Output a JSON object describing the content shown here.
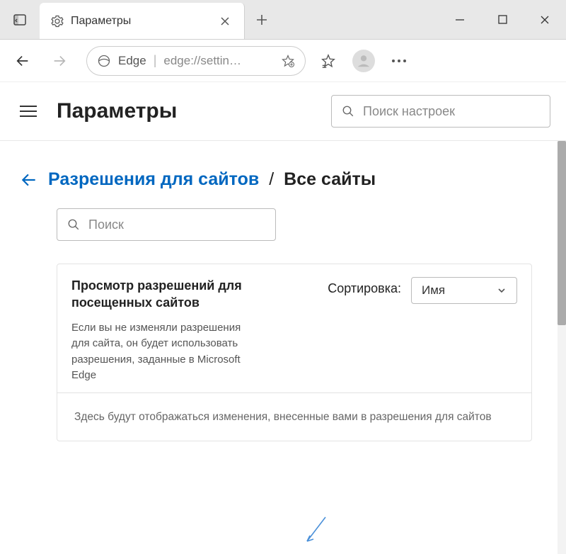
{
  "tab": {
    "title": "Параметры"
  },
  "address": {
    "engine": "Edge",
    "url": "edge://settin…"
  },
  "settings": {
    "title": "Параметры",
    "search_placeholder": "Поиск настроек"
  },
  "breadcrumb": {
    "parent": "Разрешения для сайтов",
    "current": "Все сайты"
  },
  "site_search": {
    "placeholder": "Поиск"
  },
  "card": {
    "heading": "Просмотр разрешений для посещенных сайтов",
    "desc": "Если вы не изменяли разрешения для сайта, он будет использовать разрешения, заданные в Microsoft Edge",
    "sort_label": "Сортировка:",
    "sort_value": "Имя",
    "empty_msg": "Здесь будут отображаться изменения, внесенные вами в разрешения для сайтов"
  }
}
